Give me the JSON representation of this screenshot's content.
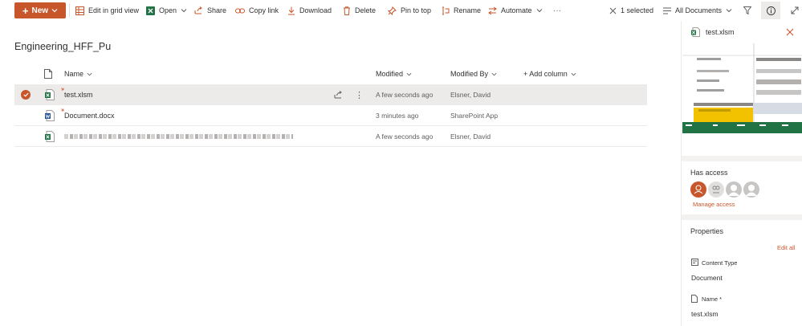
{
  "command_bar": {
    "new_label": "New",
    "edit_grid_label": "Edit in grid view",
    "open_label": "Open",
    "share_label": "Share",
    "copy_link_label": "Copy link",
    "download_label": "Download",
    "delete_label": "Delete",
    "pin_label": "Pin to top",
    "rename_label": "Rename",
    "automate_label": "Automate",
    "more_label": "···",
    "selected_label": "1 selected",
    "view_label": "All Documents"
  },
  "library": {
    "title": "Engineering_HFF_Pu",
    "columns": {
      "name": "Name",
      "modified": "Modified",
      "modified_by": "Modified By",
      "add_column": "+ Add column"
    },
    "rows": [
      {
        "name": "test.xlsm",
        "modified": "A few seconds ago",
        "modified_by": "Elsner, David",
        "type": "excel",
        "selected": true
      },
      {
        "name": "Document.docx",
        "modified": "3 minutes ago",
        "modified_by": "SharePoint App",
        "type": "word",
        "selected": false
      },
      {
        "name": "",
        "modified": "A few seconds ago",
        "modified_by": "Elsner, David",
        "type": "excel",
        "selected": false
      }
    ]
  },
  "details_pane": {
    "file_name": "test.xlsm",
    "has_access_title": "Has access",
    "manage_access_label": "Manage access",
    "properties_title": "Properties",
    "edit_all_label": "Edit all",
    "content_type_label": "Content Type",
    "content_type_value": "Document",
    "name_label": "Name *",
    "name_value": "test.xlsm"
  },
  "colors": {
    "accent": "#c7562b",
    "excel_green": "#217346",
    "word_blue": "#2b579a",
    "selected_row": "#edebe9"
  }
}
